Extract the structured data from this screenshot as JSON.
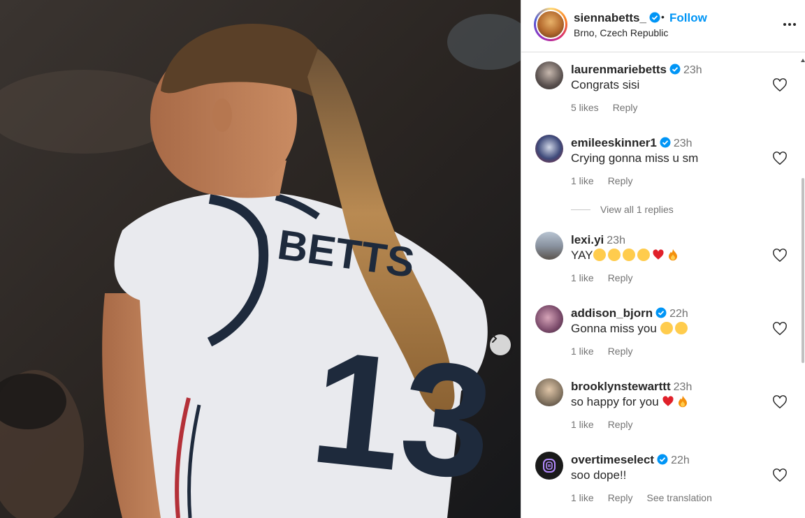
{
  "post": {
    "username": "siennabetts_",
    "follow_label": "Follow",
    "separator": "•",
    "location": "Brno, Czech Republic"
  },
  "photo": {
    "jersey_name": "BETTS",
    "jersey_number": "13"
  },
  "comments": [
    {
      "username": "laurenmariebetts",
      "verified": true,
      "time": "23h",
      "text": "Congrats sisi",
      "emojis": [],
      "likes": "5 likes",
      "reply": "Reply",
      "avatar_color": "#5b5250"
    },
    {
      "username": "emileeskinner1",
      "verified": true,
      "time": "23h",
      "text": "Crying gonna miss u sm",
      "emojis": [],
      "likes": "1 like",
      "reply": "Reply",
      "avatar_color": "#3e4a7a"
    },
    {
      "username": "lexi.yi",
      "verified": false,
      "time": "23h",
      "text": "YAY",
      "emojis": [
        "smile-icon",
        "smile-icon",
        "smile-icon",
        "smile-icon",
        "heart-icon",
        "fire-icon"
      ],
      "likes": "1 like",
      "reply": "Reply",
      "avatar_color": "#8a93a0"
    },
    {
      "username": "addison_bjorn",
      "verified": true,
      "time": "22h",
      "text": "Gonna miss you",
      "emojis": [
        "sad-icon",
        "sad-icon"
      ],
      "likes": "1 like",
      "reply": "Reply",
      "avatar_color": "#7a4a6a"
    },
    {
      "username": "brooklynstewarttt",
      "verified": false,
      "time": "23h",
      "text": "so happy for you",
      "emojis": [
        "heart-icon",
        "fire-icon"
      ],
      "likes": "1 like",
      "reply": "Reply",
      "avatar_color": "#8a7a66"
    },
    {
      "username": "overtimeselect",
      "verified": true,
      "time": "22h",
      "text": "soo dope!!",
      "emojis": [],
      "likes": "1 like",
      "reply": "Reply",
      "see_translation": "See translation",
      "avatar_color": "#1a1a1a"
    }
  ],
  "view_replies": "View all 1 replies",
  "colors": {
    "accent": "#0095f6",
    "verified": "#0095f6",
    "muted": "#737373"
  }
}
